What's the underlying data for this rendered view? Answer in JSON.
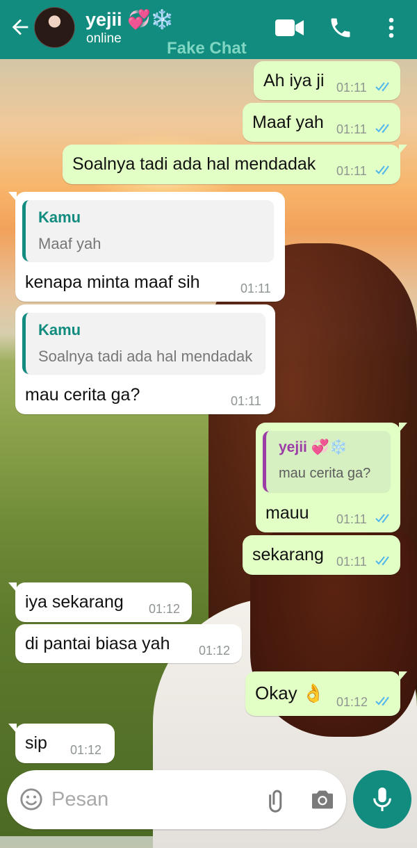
{
  "header": {
    "contact_name": "yejii 💞❄️",
    "status": "online",
    "watermark": "Fake Chat"
  },
  "messages": [
    {
      "direction": "out",
      "text": "Ah iya ji",
      "time": "01:11",
      "status": "read"
    },
    {
      "direction": "out",
      "text": "Maaf yah",
      "time": "01:11",
      "status": "read"
    },
    {
      "direction": "out",
      "text": "Soalnya tadi ada hal mendadak",
      "time": "01:11",
      "status": "read"
    },
    {
      "direction": "in",
      "reply_to": {
        "author": "Kamu",
        "text": "Maaf yah"
      },
      "text": "kenapa minta maaf sih",
      "time": "01:11"
    },
    {
      "direction": "in",
      "reply_to": {
        "author": "Kamu",
        "text": "Soalnya tadi ada hal mendadak"
      },
      "text": "mau cerita ga?",
      "time": "01:11"
    },
    {
      "direction": "out",
      "reply_to": {
        "author": "yejii 💞❄️",
        "text": "mau cerita ga?"
      },
      "text": "mauu",
      "time": "01:11",
      "status": "read"
    },
    {
      "direction": "out",
      "text": "sekarang",
      "time": "01:11",
      "status": "read"
    },
    {
      "direction": "in",
      "text": "iya sekarang",
      "time": "01:12"
    },
    {
      "direction": "in",
      "text": "di pantai biasa yah",
      "time": "01:12"
    },
    {
      "direction": "out",
      "text": "Okay 👌",
      "time": "01:12",
      "status": "read"
    },
    {
      "direction": "in",
      "text": "sip",
      "time": "01:12"
    }
  ],
  "input": {
    "placeholder": "Pesan"
  },
  "icons": {
    "back": "arrow-left-icon",
    "video": "video-call-icon",
    "call": "phone-icon",
    "menu": "more-vert-icon",
    "emoji": "emoji-icon",
    "attach": "paperclip-icon",
    "camera": "camera-icon",
    "mic": "microphone-icon"
  },
  "colors": {
    "header": "#128c7e",
    "outgoing_bubble": "#e2ffc6",
    "incoming_bubble": "#ffffff",
    "read_ticks": "#4fb6ec"
  }
}
